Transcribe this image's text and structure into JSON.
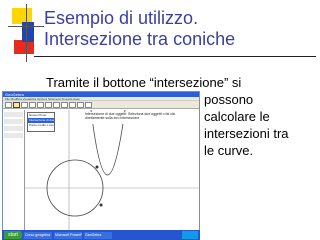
{
  "slide": {
    "title_line1": "Esempio di utilizzo.",
    "title_line2": "Intersezione tra coniche",
    "body_line1": "Tramite il bottone “intersezione” si",
    "body_rest": [
      "possono",
      "calcolare le",
      "intersezioni tra",
      "le curve."
    ]
  },
  "app": {
    "titlebar": "GeoGebra",
    "menubar": "File  Modifica  Visualizza  Opzioni  Strumenti  Finestra  Aiuto",
    "popup_items": [
      "Nuovo Punto",
      "Intersezione di due oggetti",
      "Punto medio o centro"
    ],
    "popup_selected_index": 1,
    "help_text": "Intersezione di due oggetti: Seleziona due oggetti o fai clic direttamente sulla loro intersezione"
  },
  "taskbar": {
    "start": "start",
    "tasks": [
      "Corso geogebra",
      "Microsoft PowerPoint",
      "GeoGebra"
    ]
  },
  "colors": {
    "title": "#3b3fa0",
    "deco_yellow": "#ffd700",
    "deco_red": "#e32b1f",
    "deco_blue": "#1e44b8"
  }
}
